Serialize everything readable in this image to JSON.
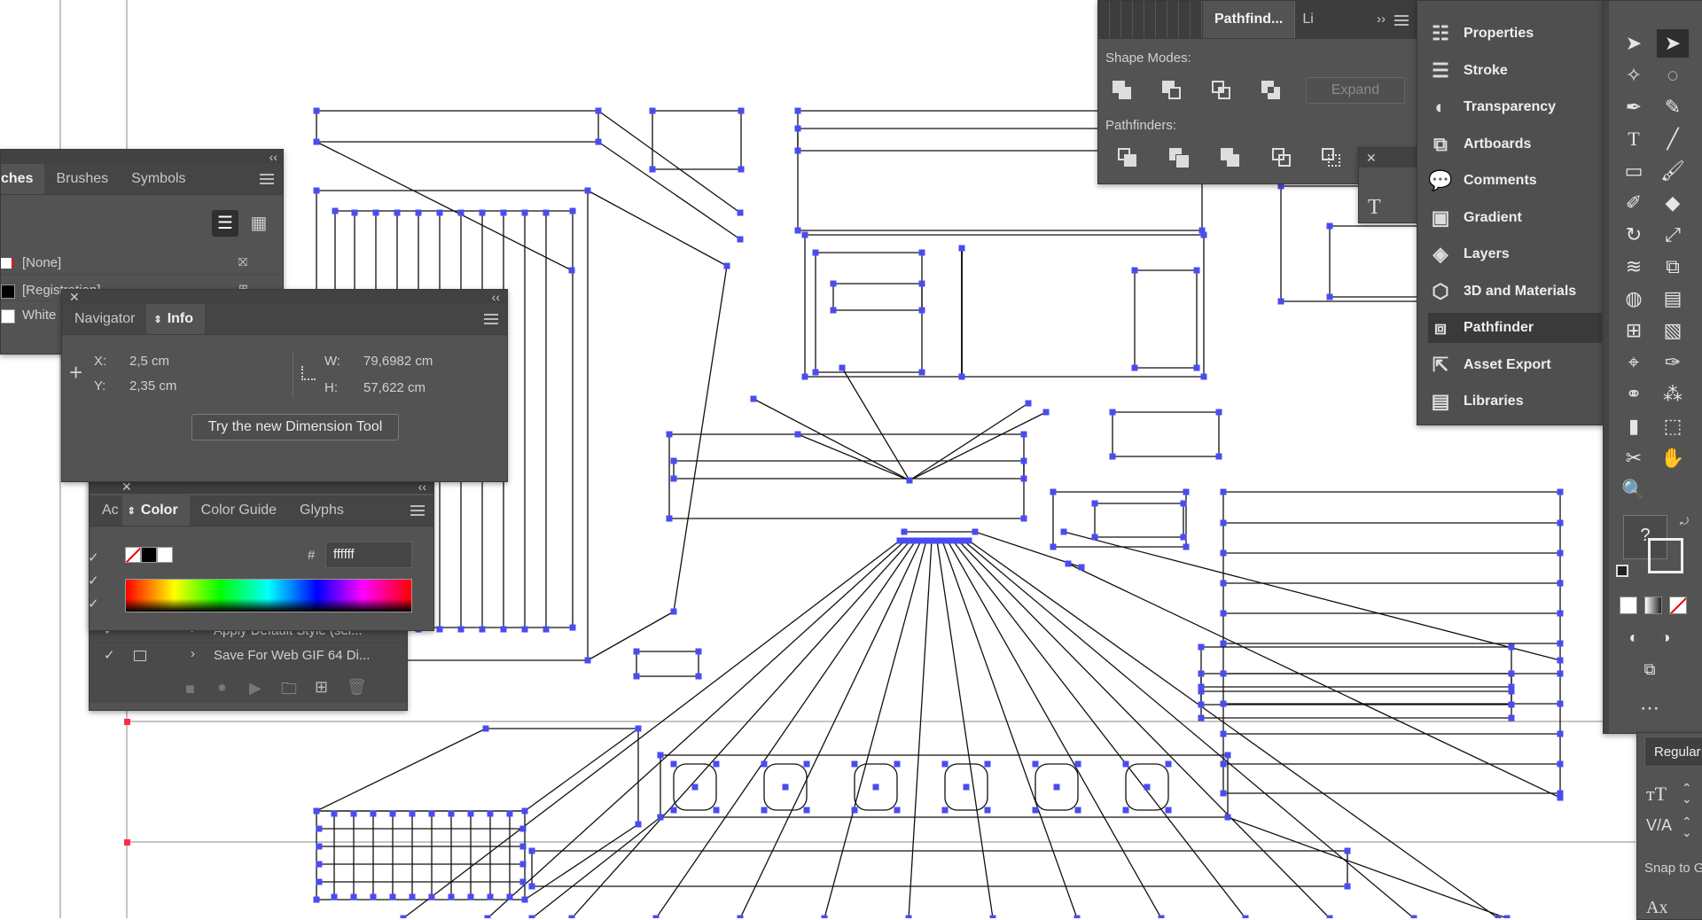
{
  "swatches_panel": {
    "tabs": [
      "ches",
      "Brushes",
      "Symbols"
    ],
    "rows": [
      {
        "name": "[None]"
      },
      {
        "name": "[Registration]"
      },
      {
        "name": "White"
      }
    ]
  },
  "info_panel": {
    "tabs": [
      "Navigator",
      "Info"
    ],
    "x_label": "X:",
    "x_value": "2,5 cm",
    "y_label": "Y:",
    "y_value": "2,35 cm",
    "w_label": "W:",
    "w_value": "79,6982 cm",
    "h_label": "H:",
    "h_value": "57,622 cm",
    "dimension_button": "Try the new Dimension Tool"
  },
  "color_panel": {
    "tabs": [
      "Ac",
      "Color",
      "Color Guide",
      "Glyphs"
    ],
    "hex_hash": "#",
    "hex_value": "ffffff"
  },
  "actions_panel": {
    "items": [
      "Apply Default Style (sel...",
      "Save For Web GIF 64 Di..."
    ]
  },
  "pathfinder_panel": {
    "tabs": [
      "Pathfind...",
      "Li"
    ],
    "shape_modes_label": "Shape Modes:",
    "expand_label": "Expand",
    "pathfinders_label": "Pathfinders:"
  },
  "properties_list": {
    "items": [
      {
        "label": "Properties",
        "icon": "sliders-icon"
      },
      {
        "label": "Stroke",
        "icon": "stroke-icon"
      },
      {
        "label": "Transparency",
        "icon": "transparency-icon"
      },
      {
        "label": "Artboards",
        "icon": "artboards-icon"
      },
      {
        "label": "Comments",
        "icon": "comments-icon"
      },
      {
        "label": "Gradient",
        "icon": "gradient-icon"
      },
      {
        "label": "Layers",
        "icon": "layers-icon"
      },
      {
        "label": "3D and Materials",
        "icon": "cube-icon"
      },
      {
        "label": "Pathfinder",
        "icon": "pathfinder-icon",
        "selected": true
      },
      {
        "label": "Asset Export",
        "icon": "export-icon"
      },
      {
        "label": "Libraries",
        "icon": "libraries-icon"
      }
    ]
  },
  "character_panel": {
    "font_style": "Regular",
    "snap_label": "Snap to G"
  },
  "colors": {
    "anchor": "#4b4bf2",
    "panel": "#535353",
    "selection_line": "#1a1a1a"
  }
}
